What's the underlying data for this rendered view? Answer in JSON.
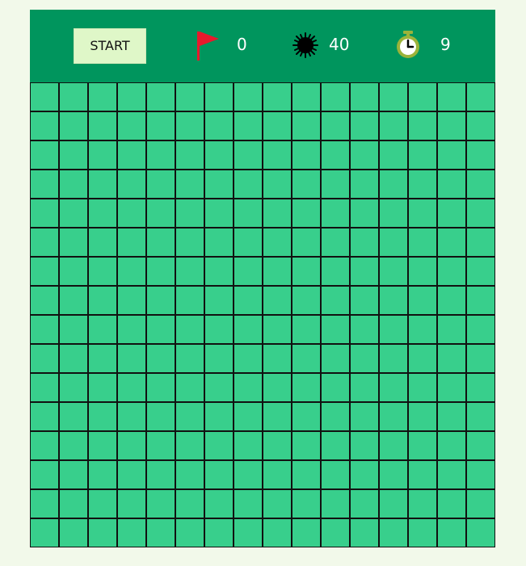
{
  "toolbar": {
    "start_label": "START",
    "flag_count": "0",
    "mine_count": "40",
    "timer": "9",
    "icons": {
      "flag": "flag-icon",
      "mine": "mine-icon",
      "timer": "stopwatch-icon"
    }
  },
  "board": {
    "rows": 16,
    "cols": 16,
    "cell_state": "unrevealed"
  },
  "colors": {
    "page_bg": "#f2f9ea",
    "header_bg": "#00955d",
    "cell": "#38cf8c",
    "cell_border": "#111111",
    "button_bg": "#dff7c8",
    "flag": "#e8192c",
    "timer": "#9bb33a"
  }
}
